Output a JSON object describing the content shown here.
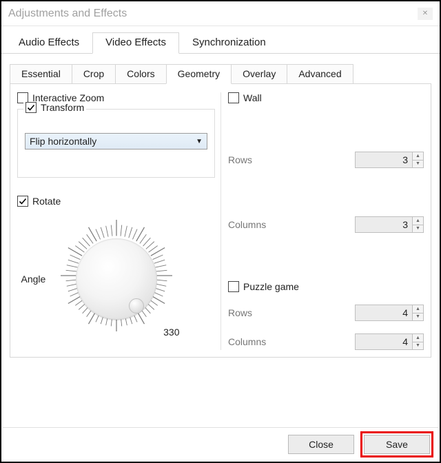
{
  "window": {
    "title": "Adjustments and Effects"
  },
  "tabs_top": {
    "items": [
      "Audio Effects",
      "Video Effects",
      "Synchronization"
    ],
    "active": 1
  },
  "tabs_sub": {
    "items": [
      "Essential",
      "Crop",
      "Colors",
      "Geometry",
      "Overlay",
      "Advanced"
    ],
    "active": 3
  },
  "geometry": {
    "interactive_zoom": {
      "label": "Interactive Zoom",
      "checked": false
    },
    "transform": {
      "label": "Transform",
      "checked": true,
      "mode": "Flip horizontally"
    },
    "rotate": {
      "label": "Rotate",
      "checked": true,
      "angle_label": "Angle",
      "angle_value": "330"
    },
    "wall": {
      "label": "Wall",
      "checked": false,
      "rows_label": "Rows",
      "rows_value": "3",
      "cols_label": "Columns",
      "cols_value": "3"
    },
    "puzzle": {
      "label": "Puzzle game",
      "checked": false,
      "rows_label": "Rows",
      "rows_value": "4",
      "cols_label": "Columns",
      "cols_value": "4"
    }
  },
  "footer": {
    "close": "Close",
    "save": "Save"
  }
}
